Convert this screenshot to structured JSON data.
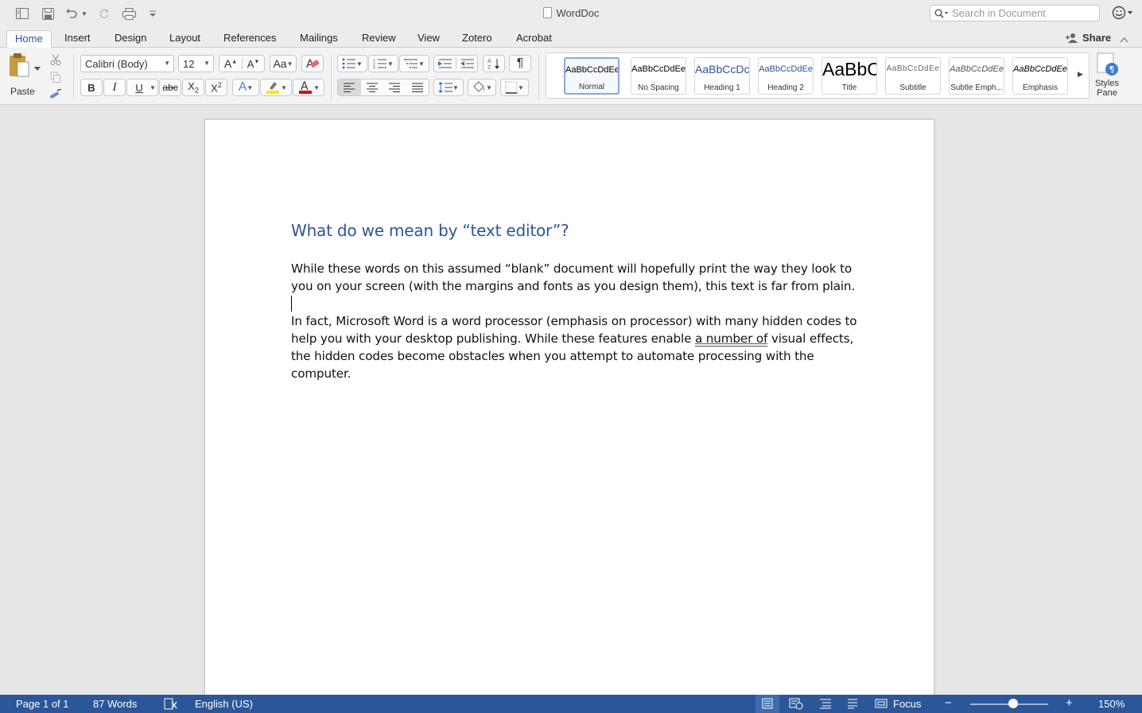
{
  "app": {
    "title": "WordDoc",
    "search_placeholder": "Search in Document"
  },
  "tabs": [
    {
      "label": "Home",
      "active": true
    },
    {
      "label": "Insert"
    },
    {
      "label": "Design"
    },
    {
      "label": "Layout"
    },
    {
      "label": "References"
    },
    {
      "label": "Mailings"
    },
    {
      "label": "Review"
    },
    {
      "label": "View"
    },
    {
      "label": "Zotero"
    },
    {
      "label": "Acrobat"
    }
  ],
  "share_label": "Share",
  "ribbon": {
    "paste_label": "Paste",
    "font_name": "Calibri (Body)",
    "font_size": "12",
    "bold": "B",
    "italic": "I",
    "underline": "U",
    "strikethrough": "abc",
    "styles": [
      {
        "sample": "AaBbCcDdEe",
        "name": "Normal"
      },
      {
        "sample": "AaBbCcDdEe",
        "name": "No Spacing"
      },
      {
        "sample": "AaBbCcDc",
        "name": "Heading 1"
      },
      {
        "sample": "AaBbCcDdEe",
        "name": "Heading 2"
      },
      {
        "sample": "AaBbC",
        "name": "Title"
      },
      {
        "sample": "AaBbCcDdEe",
        "name": "Subtitle"
      },
      {
        "sample": "AaBbCcDdEe",
        "name": "Subtle Emph..."
      },
      {
        "sample": "AaBbCcDdEe",
        "name": "Emphasis"
      }
    ],
    "styles_pane_label_1": "Styles",
    "styles_pane_label_2": "Pane"
  },
  "document": {
    "heading": "What do we mean by “text editor”?",
    "para1": "While these words on this assumed “blank” document will hopefully print the way they look to you on your screen (with the margins and fonts as you design them), this text is far from plain.",
    "para2_a": "In fact, Microsoft Word is a word processor (emphasis on processor) with many hidden codes to help you with your desktop publishing. While these features enable ",
    "para2_underlined": "a number of",
    "para2_b": " visual effects, the hidden codes become obstacles when you attempt to automate processing with the computer."
  },
  "status": {
    "page": "Page 1 of 1",
    "words": "87 Words",
    "language": "English (US)",
    "focus": "Focus",
    "zoom": "150%",
    "zoom_minus": "−",
    "zoom_plus": "+"
  },
  "colors": {
    "accent": "#2b579a",
    "heading": "#2f5496",
    "highlight": "#ffe600",
    "font_color": "#e00000"
  }
}
